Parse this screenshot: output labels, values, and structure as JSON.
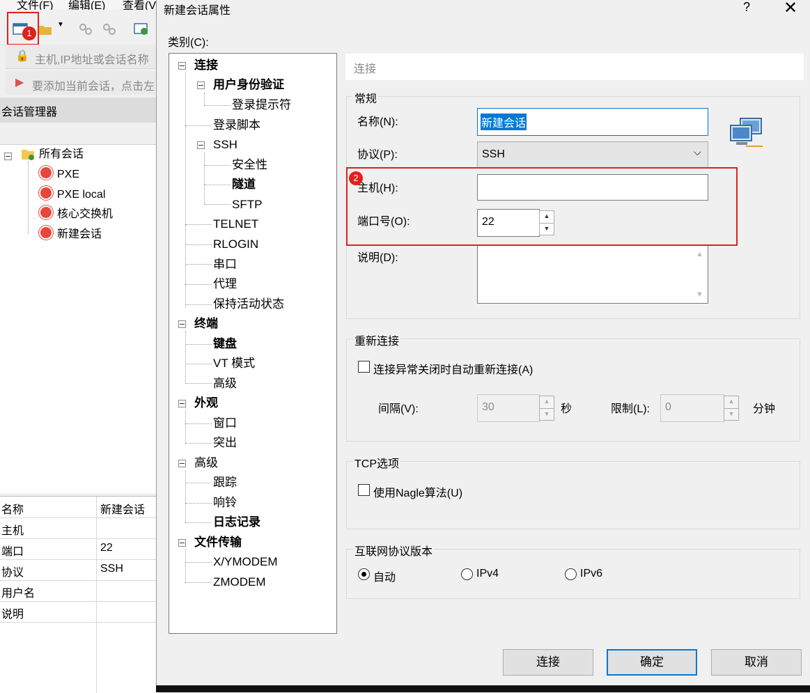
{
  "main_window": {
    "menu": [
      "文件(F)",
      "编辑(E)",
      "查看(V"
    ],
    "address_placeholder": "主机,IP地址或会话名称",
    "hint_text": "要添加当前会话，点击左",
    "session_manager": {
      "title": "会话管理器",
      "root": "所有会话",
      "items": [
        "PXE",
        "PXE local",
        "核心交换机",
        "新建会话"
      ]
    },
    "properties": [
      {
        "key": "名称",
        "value": "新建会话"
      },
      {
        "key": "主机",
        "value": ""
      },
      {
        "key": "端口",
        "value": "22"
      },
      {
        "key": "协议",
        "value": "SSH"
      },
      {
        "key": "用户名",
        "value": ""
      },
      {
        "key": "说明",
        "value": ""
      }
    ]
  },
  "dialog": {
    "title": "新建会话属性",
    "help": "?",
    "close": "✕",
    "category_label": "类别(C):",
    "tree": {
      "n0": "连接",
      "n1": "用户身份验证",
      "n2": "登录提示符",
      "n3": "登录脚本",
      "n4": "SSH",
      "n5": "安全性",
      "n6": "隧道",
      "n7": "SFTP",
      "n8": "TELNET",
      "n9": "RLOGIN",
      "n10": "串口",
      "n11": "代理",
      "n12": "保持活动状态",
      "n13": "终端",
      "n14": "键盘",
      "n15": "VT 模式",
      "n16": "高级",
      "n17": "外观",
      "n18": "窗口",
      "n19": "突出",
      "n20": "高级",
      "n21": "跟踪",
      "n22": "响铃",
      "n23": "日志记录",
      "n24": "文件传输",
      "n25": "X/YMODEM",
      "n26": "ZMODEM"
    },
    "panel_header": "连接",
    "general": {
      "title": "常规",
      "name_label": "名称(N):",
      "name_value": "新建会话",
      "protocol_label": "协议(P):",
      "protocol_value": "SSH",
      "host_label": "主机(H):",
      "host_value": "",
      "port_label": "端口号(O):",
      "port_value": "22",
      "desc_label": "说明(D):"
    },
    "reconnect": {
      "title": "重新连接",
      "checkbox_label": "连接异常关闭时自动重新连接(A)",
      "interval_label": "间隔(V):",
      "interval_value": "30",
      "interval_unit": "秒",
      "limit_label": "限制(L):",
      "limit_value": "0",
      "limit_unit": "分钟"
    },
    "tcp": {
      "title": "TCP选项",
      "nagle_label": "使用Nagle算法(U)"
    },
    "ip_version": {
      "title": "互联网协议版本",
      "options": [
        "自动",
        "IPv4",
        "IPv6"
      ],
      "selected": "自动"
    },
    "buttons": {
      "connect": "连接",
      "ok": "确定",
      "cancel": "取消"
    }
  },
  "annotations": {
    "badge1": "1",
    "badge2": "2",
    "color": "#e0201c"
  }
}
